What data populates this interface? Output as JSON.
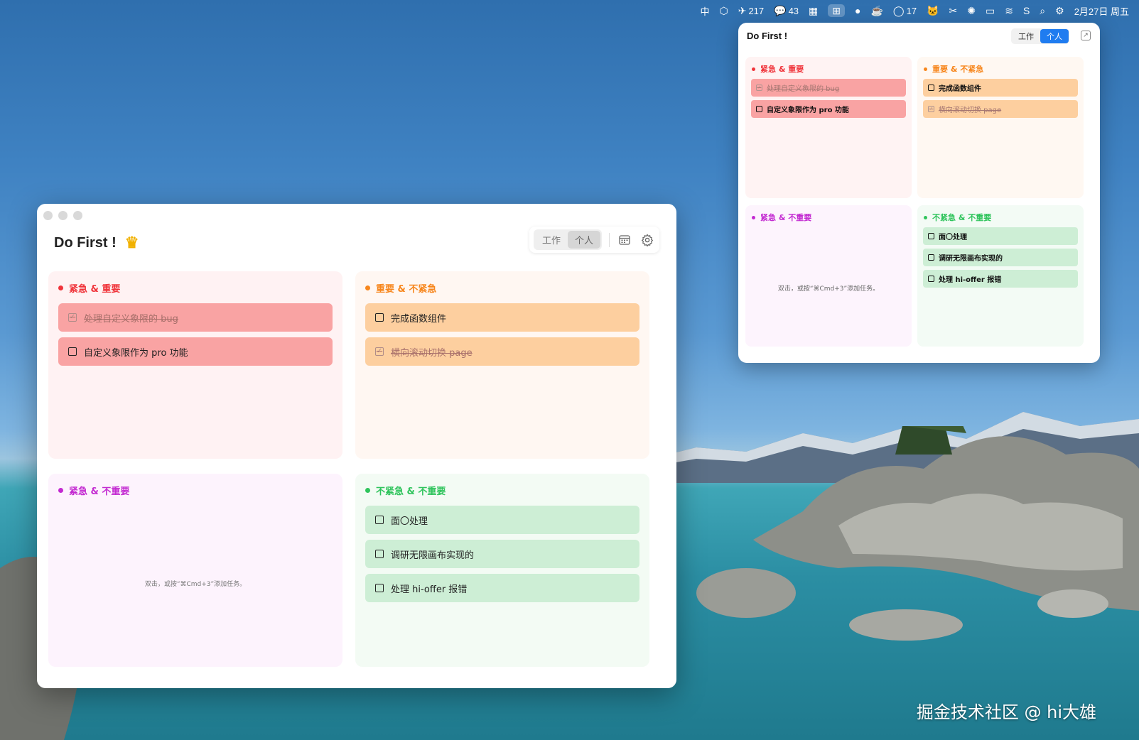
{
  "menubar": {
    "input_method": "中",
    "badge_bird": "217",
    "badge_wechat": "43",
    "badge_chat": "17",
    "datetime": "2月27日 周五"
  },
  "main_window": {
    "title": "Do First !",
    "segments": [
      "工作",
      "个人"
    ],
    "active_segment": "个人",
    "quadrants": {
      "urgent_important": {
        "title": "紧急 & 重要",
        "color": "#f0333a",
        "tasks": [
          {
            "label": "处理自定义象限的 bug",
            "done": true
          },
          {
            "label": "自定义象限作为 pro 功能",
            "done": false
          }
        ]
      },
      "important_not_urgent": {
        "title": "重要 & 不紧急",
        "color": "#f7861c",
        "tasks": [
          {
            "label": "完成函数组件",
            "done": false
          },
          {
            "label": "横向滚动切换 page",
            "done": true
          }
        ]
      },
      "urgent_not_important": {
        "title": "紧急 & 不重要",
        "color": "#c32ad1",
        "hint": "双击，或按“⌘Cmd+3”添加任务。"
      },
      "not_urgent_not_important": {
        "title": "不紧急 & 不重要",
        "color": "#2fc45c",
        "tasks": [
          {
            "label": "面〇处理",
            "done": false
          },
          {
            "label": "调研无限画布实现的",
            "done": false
          },
          {
            "label": "处理 hi-offer 报错",
            "done": false
          }
        ]
      }
    }
  },
  "mini_window": {
    "title": "Do First !",
    "segments": [
      "工作",
      "个人"
    ],
    "active_segment": "个人",
    "quadrants": {
      "urgent_important": {
        "title": "紧急 & 重要",
        "tasks": [
          {
            "label": "处理自定义象限的 bug",
            "done": true
          },
          {
            "label": "自定义象限作为 pro 功能",
            "done": false
          }
        ]
      },
      "important_not_urgent": {
        "title": "重要 & 不紧急",
        "tasks": [
          {
            "label": "完成函数组件",
            "done": false
          },
          {
            "label": "横向滚动切换 page",
            "done": true
          }
        ]
      },
      "urgent_not_important": {
        "title": "紧急 & 不重要",
        "hint": "双击，或按“⌘Cmd+3”添加任务。"
      },
      "not_urgent_not_important": {
        "title": "不紧急 & 不重要",
        "tasks": [
          {
            "label": "面〇处理",
            "done": false
          },
          {
            "label": "调研无限画布实现的",
            "done": false
          },
          {
            "label": "处理 hi-offer 报错",
            "done": false
          }
        ]
      }
    }
  },
  "watermark": "掘金技术社区 @ hi大雄"
}
